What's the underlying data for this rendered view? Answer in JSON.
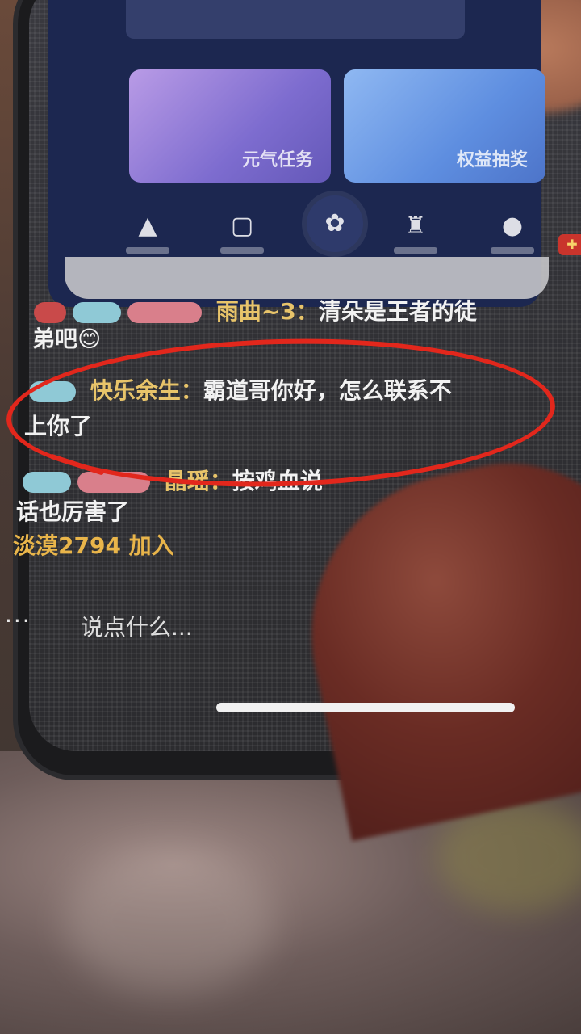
{
  "app_cards": [
    {
      "label": "元气任务"
    },
    {
      "label": "权益抽奖"
    }
  ],
  "nav_items": [
    {
      "icon": "mountain-icon"
    },
    {
      "icon": "bag-icon"
    },
    {
      "icon": "paw-icon"
    },
    {
      "icon": "trophy-icon"
    },
    {
      "icon": "person-icon"
    }
  ],
  "chat": {
    "message1": {
      "user": "雨曲~3：",
      "text": "清朵是王者的徒",
      "text_cont": "弟吧😊"
    },
    "message2": {
      "user": "快乐余生：",
      "text": "霸道哥你好，怎么联系不",
      "text_cont": "上你了"
    },
    "message3": {
      "user": "晶瑶：",
      "text": "按鸡血说",
      "text_cont": "话也厉害了"
    },
    "join": "淡漠2794 加入"
  },
  "input": {
    "more": "···",
    "placeholder": "说点什么..."
  },
  "colors": {
    "annotation_ring": "#e2271c",
    "username": "#e8c46a",
    "join_text": "#e9b54a"
  }
}
